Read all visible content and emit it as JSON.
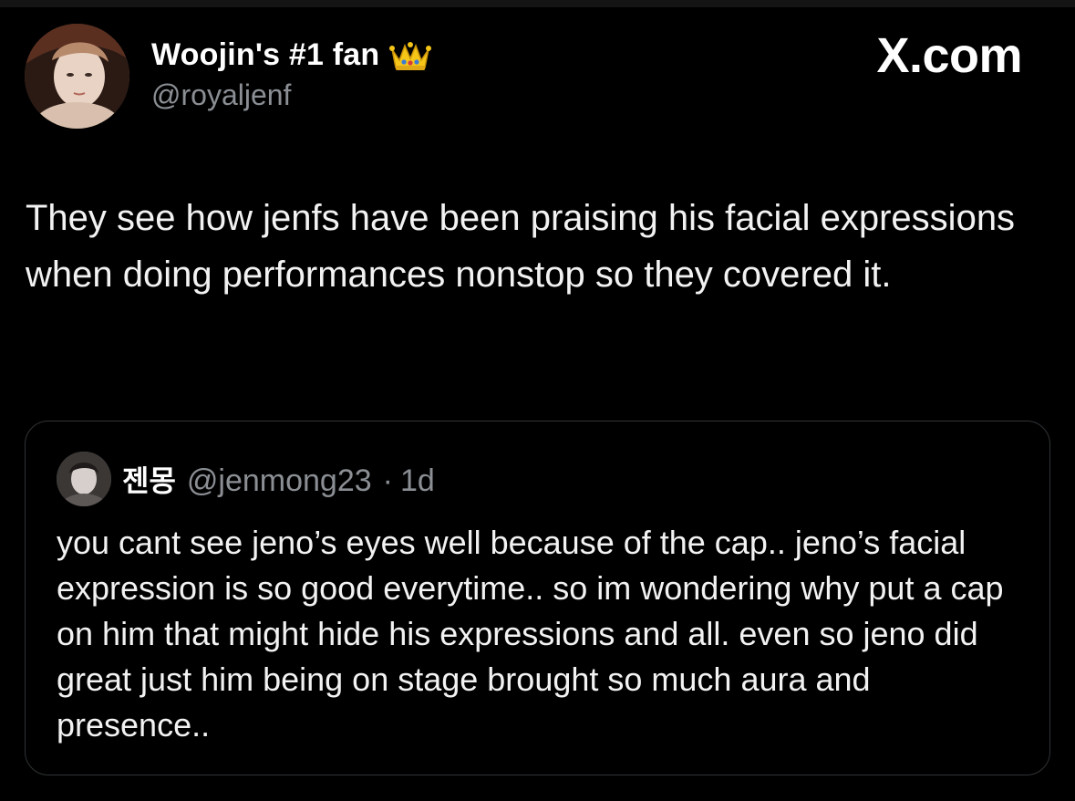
{
  "brand": "X.com",
  "tweet": {
    "author_name": "Woojin's #1 fan",
    "author_handle": "@royaljenf",
    "name_icon": "crown-emoji",
    "text": "They see how jenfs have been praising his facial expressions when doing performances nonstop so they covered it."
  },
  "quoted_tweet": {
    "author_name": "젠몽",
    "author_handle": "@jenmong23",
    "separator": "·",
    "time": "1d",
    "text": "you cant see jeno’s eyes well because of the cap.. jeno’s facial expression is so good everytime.. so im wondering why put a cap on him that might hide his expressions and all. even so jeno did great just him being on stage brought so much aura and presence.."
  },
  "colors": {
    "background": "#000000",
    "text": "#f2f2f2",
    "secondary_text": "#8b8f94",
    "border": "#2f3336",
    "crown": "#f5c518"
  }
}
